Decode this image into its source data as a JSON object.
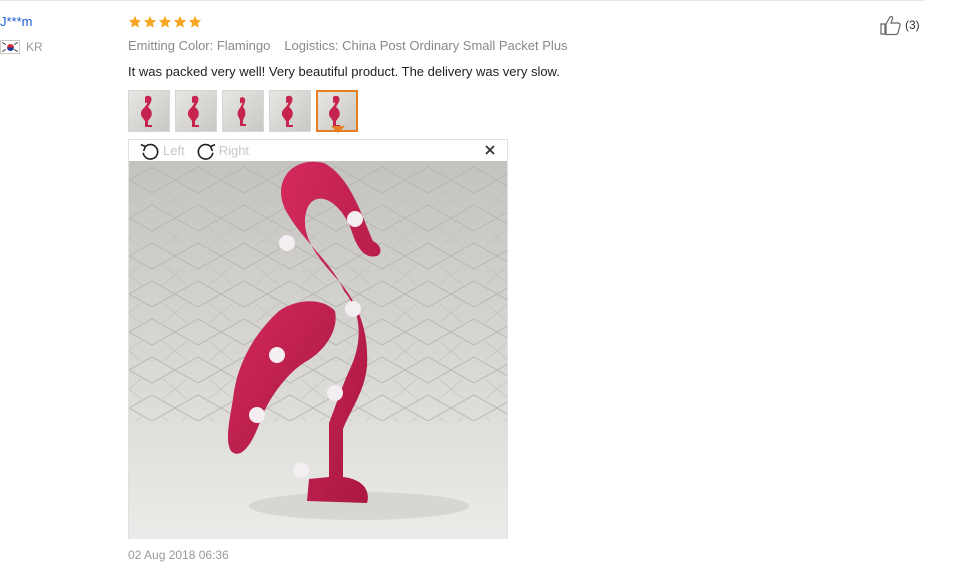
{
  "user": {
    "name": "J***m",
    "country_code": "KR"
  },
  "review": {
    "rating": 5,
    "emitting_color": "Emitting Color: Flamingo",
    "logistics": "Logistics: China Post Ordinary Small Packet Plus",
    "text": "It was packed very well! Very beautiful product. The delivery was very slow.",
    "date": "02 Aug 2018 06:36",
    "thumbnails_count": 5,
    "active_thumbnail": 5
  },
  "viewer": {
    "rotate_left": "Left",
    "rotate_right": "Right"
  },
  "helpful": {
    "count": "(3)"
  },
  "colors": {
    "star": "#f5a623",
    "accent": "#e67e22",
    "link": "#1a5bd6",
    "flamingo": "#c7234f"
  }
}
